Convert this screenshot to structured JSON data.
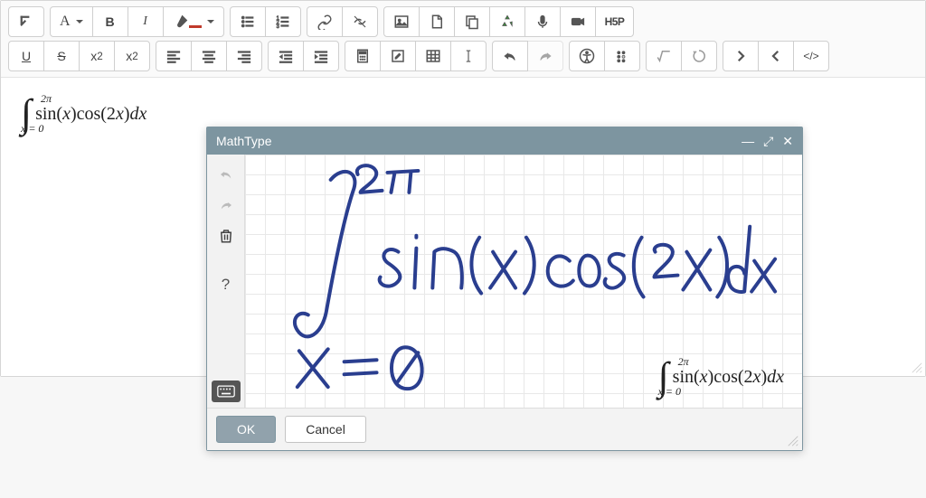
{
  "toolbar": {
    "row1": {
      "expand": "expand-toolbar",
      "font_label": "A",
      "bold_label": "B",
      "italic_label": "I",
      "brush": "highlight-color",
      "ul": "unordered-list",
      "ol": "ordered-list",
      "link": "insert-link",
      "unlink": "remove-link",
      "image": "insert-image",
      "file": "insert-file",
      "copy": "paste",
      "circle": "embed",
      "mic": "record-audio",
      "video": "record-video",
      "h5p_label": "H5P"
    },
    "row2": {
      "underline_label": "U",
      "strike_label": "S",
      "sub_label": "x",
      "sub_suffix": "2",
      "sup_label": "x",
      "sup_suffix": "2",
      "align_l": "align-left",
      "align_c": "align-center",
      "align_r": "align-right",
      "outdent": "outdent",
      "indent": "indent",
      "calc": "calculator",
      "edit": "compose",
      "table": "insert-table",
      "cursor": "text-cursor",
      "undo": "undo",
      "redo": "redo",
      "a11y": "accessibility-checker",
      "braille": "braille",
      "sqrt": "math-editor",
      "chem": "chem-editor",
      "next": "next",
      "prev": "prev",
      "code_label": "</>"
    }
  },
  "content": {
    "formula_upper": "2π",
    "formula_lower": "x = 0",
    "formula_body_plain": "sin(x)cos(2x)dx"
  },
  "modal": {
    "title": "MathType",
    "ok_label": "OK",
    "cancel_label": "Cancel",
    "render_upper": "2π",
    "render_lower": "x = 0",
    "render_body": "sin(x)cos(2x)dx",
    "handwriting_expression": "∫ from x=0 to 2π of sin(x) cos(2x) dx"
  }
}
